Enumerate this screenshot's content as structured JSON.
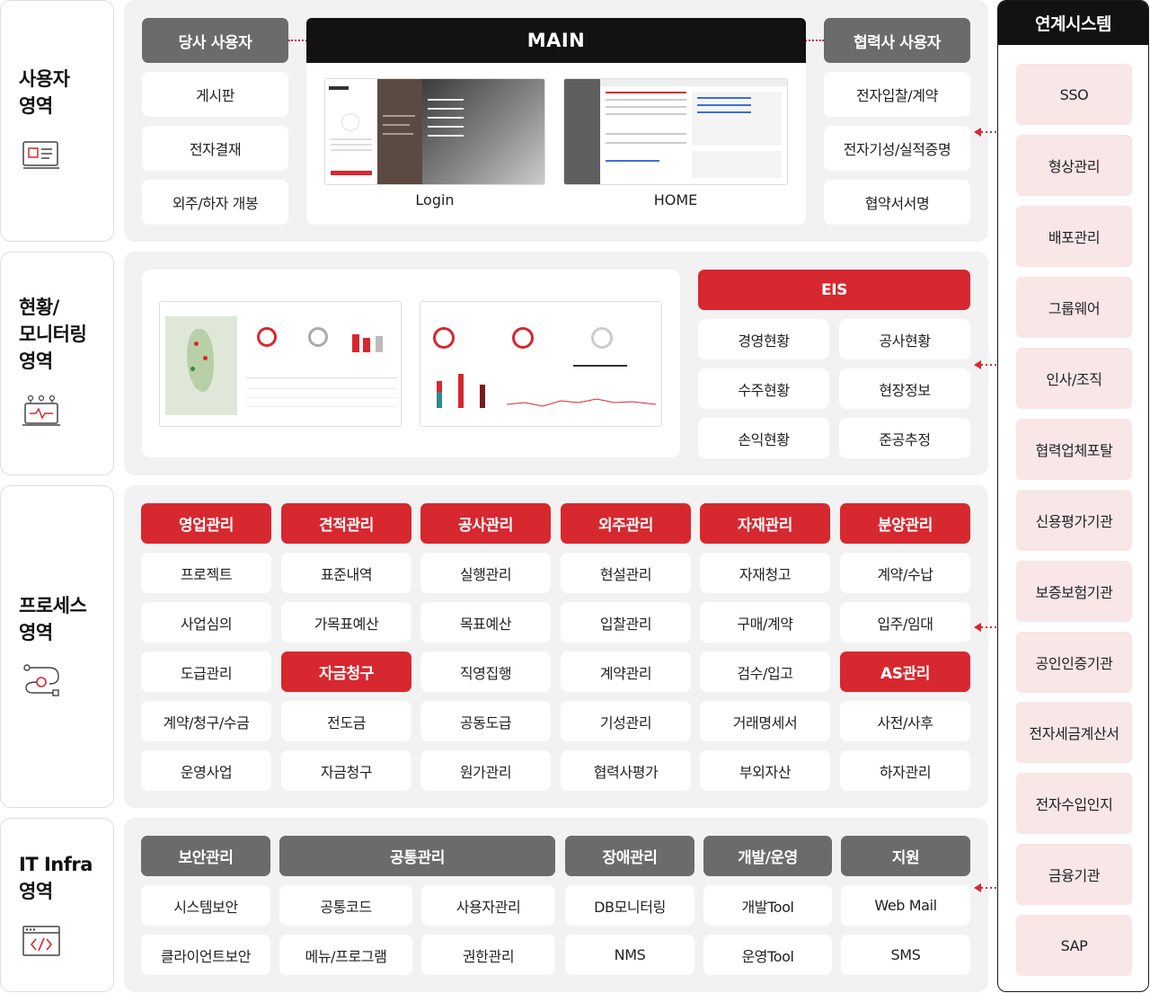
{
  "areas": {
    "user": "사용자\n영역",
    "monitoring": "현황/\n모니터링\n영역",
    "process": "프로세스\n영역",
    "infra": "IT Infra\n영역"
  },
  "user_area": {
    "internal_header": "당사 사용자",
    "internal_items": [
      "게시판",
      "전자결재",
      "외주/하자 개봉"
    ],
    "main_header": "MAIN",
    "screens": [
      "Login",
      "HOME"
    ],
    "partner_header": "협력사 사용자",
    "partner_items": [
      "전자입찰/계약",
      "전자기성/실적증명",
      "협약서서명"
    ]
  },
  "monitoring_area": {
    "eis_header": "EIS",
    "eis_items": [
      "경영현황",
      "공사현황",
      "수주현황",
      "현장정보",
      "손익현황",
      "준공추정"
    ]
  },
  "process_area": {
    "columns": [
      {
        "header": "영업관리",
        "items": [
          "프로젝트",
          "사업심의",
          "도급관리",
          "계약/청구/수금",
          "운영사업"
        ]
      },
      {
        "header": "견적관리",
        "items": [
          "표준내역",
          "가목표예산",
          "자금청구",
          "전도금",
          "자금청구"
        ]
      },
      {
        "header": "공사관리",
        "items": [
          "실행관리",
          "목표예산",
          "직영집행",
          "공동도급",
          "원가관리"
        ]
      },
      {
        "header": "외주관리",
        "items": [
          "현설관리",
          "입찰관리",
          "계약관리",
          "기성관리",
          "협력사평가"
        ]
      },
      {
        "header": "자재관리",
        "items": [
          "자재청고",
          "구매/계약",
          "검수/입고",
          "거래명세서",
          "부외자산"
        ]
      },
      {
        "header": "분양관리",
        "items": [
          "계약/수납",
          "입주/임대",
          "AS관리",
          "사전/사후",
          "하자관리"
        ]
      }
    ]
  },
  "infra_area": {
    "groups": [
      {
        "header": "보안관리",
        "items": [
          "시스템보안",
          "클라이언트보안"
        ]
      },
      {
        "header": "공통관리",
        "items": [
          "공통코드",
          "사용자관리",
          "메뉴/프로그램",
          "권한관리"
        ]
      },
      {
        "header": "장애관리",
        "items": [
          "DB모니터링",
          "NMS"
        ]
      },
      {
        "header": "개발/운영",
        "items": [
          "개발Tool",
          "운영Tool"
        ]
      },
      {
        "header": "지원",
        "items": [
          "Web Mail",
          "SMS"
        ]
      }
    ]
  },
  "linked_systems": {
    "header": "연계시스템",
    "items": [
      "SSO",
      "형상관리",
      "배포관리",
      "그룹웨어",
      "인사/조직",
      "협력업체포탈",
      "신용평가기관",
      "보증보험기관",
      "공인인증기관",
      "전자세금계산서",
      "전자수입인지",
      "금융기관",
      "SAP"
    ]
  },
  "colors": {
    "accent_red": "#d7282f",
    "header_gray": "#6b6b6b",
    "header_black": "#121212",
    "panel_bg": "#f2f2f2",
    "system_bg": "#f9e6e7"
  },
  "icons": [
    "web-page-icon",
    "monitoring-icon",
    "process-flow-icon",
    "code-window-icon"
  ]
}
